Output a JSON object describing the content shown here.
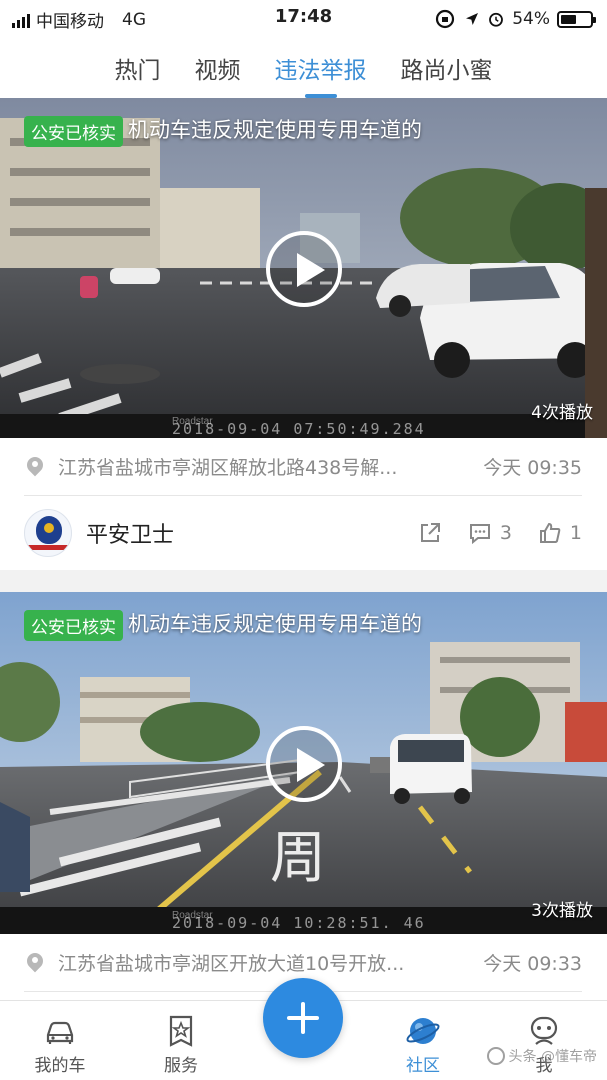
{
  "status_bar": {
    "carrier": "中国移动",
    "network": "4G",
    "time": "17:48",
    "battery": "54%",
    "battery_level": 0.54
  },
  "tabs": [
    {
      "label": "热门",
      "active": false
    },
    {
      "label": "视频",
      "active": false
    },
    {
      "label": "违法举报",
      "active": true
    },
    {
      "label": "路尚小蜜",
      "active": false
    }
  ],
  "posts": [
    {
      "badge": "公安已核实",
      "title": "机动车违反规定使用专用车道的",
      "play_count": "4次播放",
      "video_brand": "Roadstar",
      "video_timestamp": "2018-09-04 07:50:49.284",
      "location": "江苏省盐城市亭湖区解放北路438号解...",
      "time": "今天 09:35",
      "user": "平安卫士",
      "avatar_text": "人民公安为人民",
      "comments": "3",
      "likes": "1"
    },
    {
      "badge": "公安已核实",
      "title": "机动车违反规定使用专用车道的",
      "play_count": "3次播放",
      "video_brand": "Roadstar",
      "video_timestamp": "2018-09-04 10:28:51. 46",
      "location": "江苏省盐城市亭湖区开放大道10号开放...",
      "time": "今天 09:33"
    }
  ],
  "road_marking": "周",
  "bottom_nav": [
    {
      "label": "我的车",
      "icon": "car-icon",
      "active": false
    },
    {
      "label": "服务",
      "icon": "service-icon",
      "active": false
    },
    {
      "label": "社区",
      "icon": "planet-icon",
      "active": true
    },
    {
      "label": "我",
      "icon": "profile-icon",
      "active": false
    }
  ],
  "fab_icon": "plus-icon",
  "watermark": "头条 @懂车帝",
  "colors": {
    "accent": "#3d8fd6",
    "verified_badge": "#37b24d",
    "fab": "#2d8ae0"
  }
}
